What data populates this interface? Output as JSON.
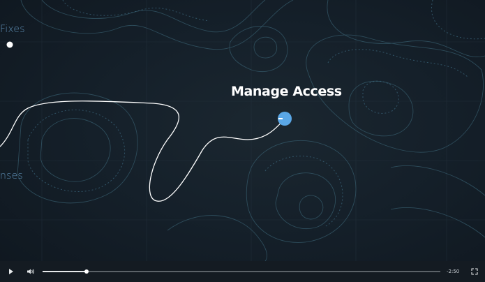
{
  "map": {
    "labels": {
      "fixes": "Fixes",
      "nses": "nses"
    },
    "title": "Manage Access"
  },
  "player": {
    "time_remaining": "-2:50",
    "progress_fraction": 0.11,
    "icons": {
      "play": "play-icon",
      "volume": "volume-icon",
      "fullscreen": "fullscreen-icon"
    }
  },
  "colors": {
    "background": "#15202a",
    "label_blue": "#5d8db3",
    "node_blue": "#5aa7e6",
    "path_white": "#ffffff"
  }
}
